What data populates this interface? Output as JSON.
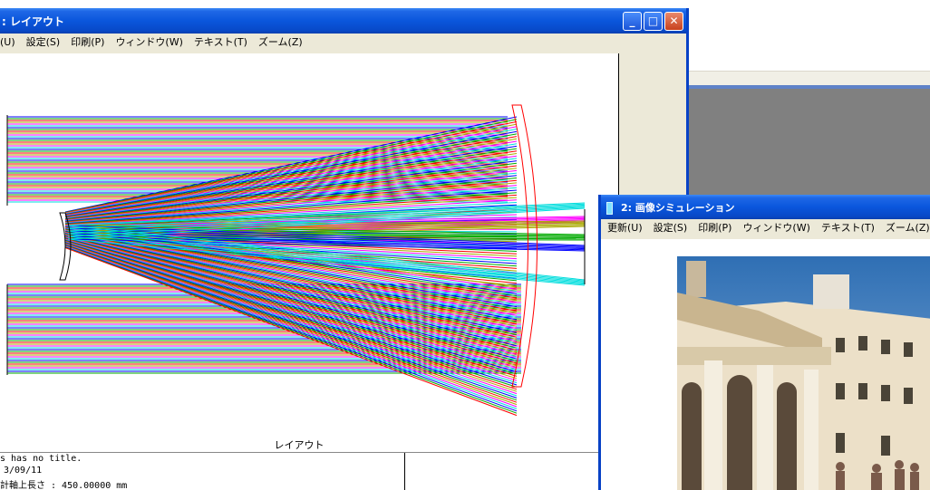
{
  "layout_window": {
    "title": ": レイアウト",
    "menu": [
      "(U)",
      "設定(S)",
      "印刷(P)",
      "ウィンドウ(W)",
      "テキスト(T)",
      "ズーム(Z)"
    ],
    "status": "レイアウト",
    "info_lines": [
      "s has no title.",
      "3/09/11",
      "計軸上長さ : 450.00000 mm"
    ],
    "buttons": {
      "minimize": "_",
      "maximize": "□",
      "close": "✕"
    }
  },
  "sim_window": {
    "title": "2: 画像シミュレーション",
    "menu": [
      "更新(U)",
      "設定(S)",
      "印刷(P)",
      "ウィンドウ(W)",
      "テキスト(T)",
      "ズーム(Z)"
    ]
  },
  "ray_colors": [
    "#0000ff",
    "#00aa00",
    "#ff0000",
    "#aaaa00",
    "#ff00ff",
    "#00dddd"
  ],
  "icons": [
    "minimize-icon",
    "maximize-icon",
    "close-icon",
    "app-icon"
  ]
}
